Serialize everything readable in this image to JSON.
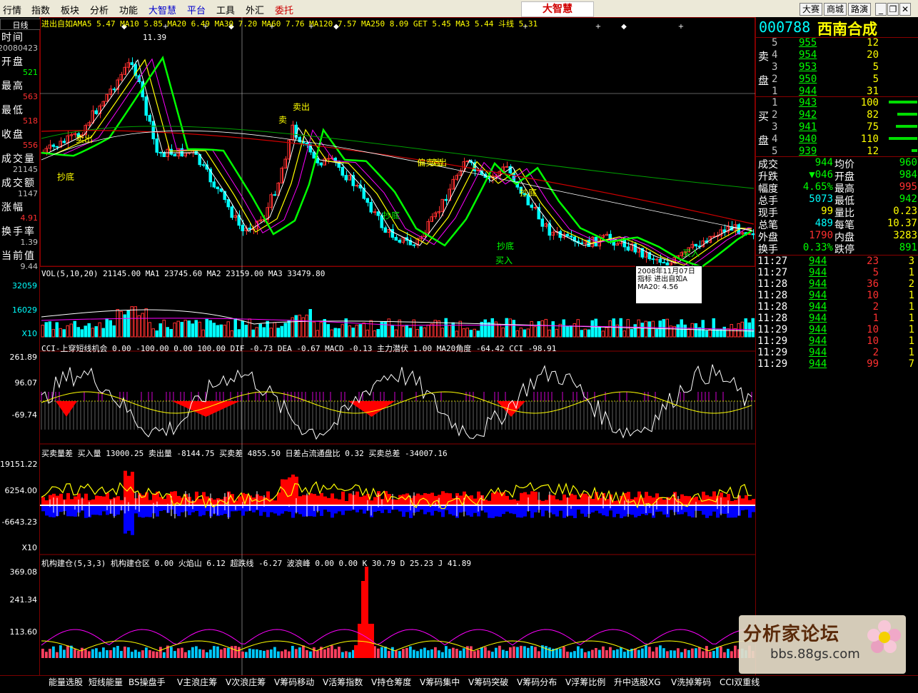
{
  "menu": {
    "items": [
      "行情",
      "指数",
      "板块",
      "分析",
      "功能",
      "大智慧",
      "平台",
      "工具",
      "外汇",
      "委托"
    ],
    "brand": "大智慧",
    "right_buttons": [
      "大赛",
      "商城",
      "路演"
    ]
  },
  "left": {
    "period": "日线",
    "rows": [
      {
        "label": "时间",
        "value": "20080423",
        "color": "#c0c0c0"
      },
      {
        "label": "开盘",
        "value": "521",
        "color": "#00ff00"
      },
      {
        "label": "最高",
        "value": "563",
        "color": "#ff3030"
      },
      {
        "label": "最低",
        "value": "518",
        "color": "#ff3030"
      },
      {
        "label": "收盘",
        "value": "556",
        "color": "#ff3030"
      },
      {
        "label": "成交量",
        "value": "21145",
        "color": "#c0c0c0"
      },
      {
        "label": "成交额",
        "value": "1147",
        "color": "#c0c0c0"
      },
      {
        "label": "涨幅",
        "value": "4.91",
        "color": "#ff3030"
      },
      {
        "label": "换手率",
        "value": "1.39",
        "color": "#c0c0c0"
      },
      {
        "label": "当前值",
        "value": "9.44",
        "color": "#c0c0c0"
      }
    ]
  },
  "main_chart": {
    "header": "进出自如AMA5 5.47 MA10 5.85 MA20 6.49 MA30 7.20 MA60 7.76 MA120 7.57 MA250 8.09 GET 5.45 MA3 5.44 斗线 5.31",
    "price_high_label": "11.39",
    "annotations": [
      "抄底",
      "卖出",
      "卖",
      "卖出",
      "偏卖出",
      "卖出",
      "抄底",
      "抄底",
      "抄底",
      "买入",
      "买入"
    ],
    "tooltip": [
      "2008年11月07日",
      "指标 进出自如A",
      "MA20: 4.56"
    ]
  },
  "vol_panel": {
    "header": "VOL(5,10,20)  21145.00  MA1 23745.60  MA2 23159.00  MA3 33479.80",
    "ticks": [
      "32059",
      "16029",
      "X10"
    ]
  },
  "cci_panel": {
    "header": "CCI-上穿短线机会 0.00  -100.00  0.00  100.00  DIF -0.73  DEA -0.67  MACD -0.13  主力潜伏 1.00  MA20角度 -64.42  CCI -98.91",
    "ticks": [
      "261.89",
      "96.07",
      "-69.74"
    ]
  },
  "flow_panel": {
    "header": "买卖量差 买入量 13000.25  卖出量 -8144.75  买卖差 4855.50  日差占流通盘比 0.32  买卖总差 -34007.16",
    "ticks": [
      "19151.22",
      "6254.00",
      "-6643.23",
      "X10"
    ]
  },
  "inst_panel": {
    "header": "机构建仓(5,3,3)  机构建仓区 0.00  火焰山 6.12  超跌线 -6.27  波浪峰 0.00  0.00  K 30.79  D 25.23  J 41.89",
    "ticks": [
      "369.08",
      "241.34",
      "113.60"
    ]
  },
  "quote": {
    "code": "000788",
    "name": "西南合成",
    "sell_label": "卖盘",
    "buy_label": "买盘",
    "asks": [
      {
        "level": "5",
        "price": "955",
        "vol": "12"
      },
      {
        "level": "4",
        "price": "954",
        "vol": "20"
      },
      {
        "level": "3",
        "price": "953",
        "vol": "5"
      },
      {
        "level": "2",
        "price": "950",
        "vol": "5"
      },
      {
        "level": "1",
        "price": "944",
        "vol": "31"
      }
    ],
    "bids": [
      {
        "level": "1",
        "price": "943",
        "vol": "100"
      },
      {
        "level": "2",
        "price": "942",
        "vol": "82"
      },
      {
        "level": "3",
        "price": "941",
        "vol": "75"
      },
      {
        "level": "4",
        "price": "940",
        "vol": "110"
      },
      {
        "level": "5",
        "price": "939",
        "vol": "12"
      }
    ],
    "stats": [
      {
        "l1": "成交",
        "v1": "944",
        "l2": "均价",
        "v2": "960"
      },
      {
        "l1": "升跌",
        "v1": "▼046",
        "l2": "开盘",
        "v2": "984"
      },
      {
        "l1": "幅度",
        "v1": "4.65%",
        "l2": "最高",
        "v2": "995"
      },
      {
        "l1": "总手",
        "v1": "5073",
        "l2": "最低",
        "v2": "942"
      },
      {
        "l1": "现手",
        "v1": "99",
        "l2": "量比",
        "v2": "0.23"
      },
      {
        "l1": "总笔",
        "v1": "489",
        "l2": "每笔",
        "v2": "10.37"
      },
      {
        "l1": "外盘",
        "v1": "1790",
        "l2": "内盘",
        "v2": "3283"
      },
      {
        "l1": "换手",
        "v1": "0.33%",
        "l2": "跌停",
        "v2": "891"
      }
    ],
    "ticks": [
      {
        "time": "11:27",
        "price": "944",
        "vol": "23",
        "n": "3"
      },
      {
        "time": "11:27",
        "price": "944",
        "vol": "5",
        "n": "1"
      },
      {
        "time": "11:28",
        "price": "944",
        "vol": "36",
        "n": "2"
      },
      {
        "time": "11:28",
        "price": "944",
        "vol": "10",
        "n": "1"
      },
      {
        "time": "11:28",
        "price": "944",
        "vol": "2",
        "n": "1"
      },
      {
        "time": "11:28",
        "price": "944",
        "vol": "1",
        "n": "1"
      },
      {
        "time": "11:29",
        "price": "944",
        "vol": "10",
        "n": "1"
      },
      {
        "time": "11:29",
        "price": "944",
        "vol": "10",
        "n": "1"
      },
      {
        "time": "11:29",
        "price": "944",
        "vol": "2",
        "n": "1"
      },
      {
        "time": "11:29",
        "price": "944",
        "vol": "99",
        "n": "7"
      }
    ]
  },
  "bottom_tabs": [
    "能量选股",
    "短线能量",
    "BS操盘手",
    "V主浪庄筹",
    "V次浪庄筹",
    "V筹码移动",
    "V活筹指数",
    "V持仓筹度",
    "V筹码集中",
    "V筹码突破",
    "V筹码分布",
    "V浮筹比例",
    "升中选股XG",
    "V洗掉筹码",
    "CCI双重线"
  ],
  "watermark": {
    "title": "分析家论坛",
    "url": "bbs.88gs.com"
  },
  "colors": {
    "up": "#ff3030",
    "down": "#00ffff",
    "grid": "#800000",
    "axis": "#c0c0c0"
  }
}
